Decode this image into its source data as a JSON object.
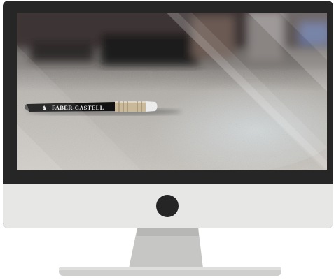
{
  "screen_content": {
    "pencil_brand": "FABER-CASTELL"
  },
  "colors": {
    "bezel": "#262626",
    "chin": "#e7e7e5",
    "home_button": "#252525",
    "stand": "#c9c9c7",
    "base": "#cfcfcd"
  }
}
